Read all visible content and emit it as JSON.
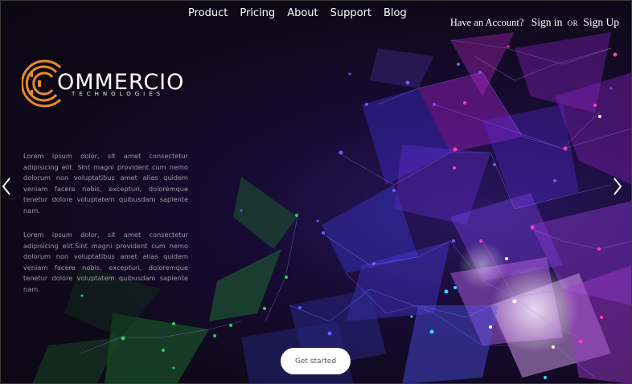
{
  "nav": {
    "items": [
      {
        "label": "Product"
      },
      {
        "label": "Pricing"
      },
      {
        "label": "About"
      },
      {
        "label": "Support"
      },
      {
        "label": "Blog"
      }
    ]
  },
  "account": {
    "question": "Have an Account?",
    "signin": "Sign in",
    "or": "OR",
    "signup": "Sign Up"
  },
  "logo": {
    "word": "OMMERCIO",
    "sub": "TECHNOLOGIES",
    "accent": "#e8892a"
  },
  "intro": {
    "paragraph1": "Lorem ipsum dolor, sit amet consectetur adipisicing elit. Sint magni provident cum nemo dolorum non voluptatibus amet alias quidem veniam facere nobis, excepturi, doloremque tenetur dolore voluptatem quibusdam sapiente nam.",
    "paragraph2": "Lorem ipsum dolor, sit amet consectetur adipisicing elit.Sint magni provident cum nemo dolorum non voluptatibus amet alias quidem veniam facere nobis, excepturi, doloremque tenetur dolore voluptatem quibusdam sapiente nam."
  },
  "carousel": {
    "prev_icon": "chevron-left-icon",
    "next_icon": "chevron-right-icon"
  },
  "cta": {
    "label": "Get started"
  },
  "colors": {
    "background": "#0d0a12",
    "violet": "#6a3cff",
    "magenta": "#d63be8",
    "green": "#2ea84a",
    "cyan": "#5ad6ff"
  }
}
